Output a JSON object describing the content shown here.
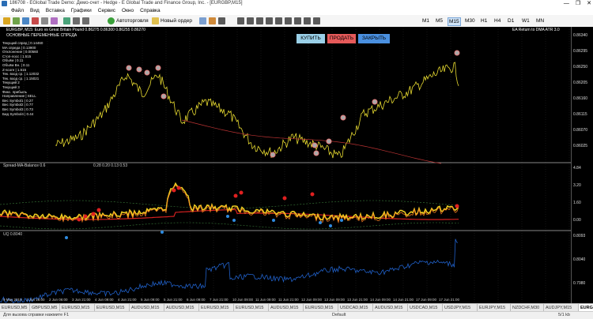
{
  "window": {
    "title": "186708 - EGlobal Trade Demo: Демо-счет - Hedge - E Global Trade and Finance Group, Inc. - [EURGBP,M15]",
    "controls": [
      "—",
      "❐",
      "✕"
    ]
  },
  "menu": [
    "Файл",
    "Вид",
    "Вставка",
    "Графики",
    "Сервис",
    "Окно",
    "Справка"
  ],
  "toolbar": {
    "algo_label": "Автоторговля",
    "new_order_label": "Новый ордер",
    "timeframes": [
      "M1",
      "M5",
      "M15",
      "M30",
      "H1",
      "H4",
      "D1",
      "W1",
      "MN"
    ],
    "active_timeframe": "M15"
  },
  "chart": {
    "header": "EURGBP, M15: Euro vs Great Britain Pound  0.86275  0.86300  0.86255  0.86270",
    "header_sub": "ОСНОВНЫЕ ПЕРЕМЕННЫЕ СПРЕДА",
    "ea_label": "EA Return to DMA ATR 3.0",
    "buttons": {
      "buy": "КУПИТЬ",
      "sell": "ПРОДАТЬ (2)",
      "close": "ЗАКРЫТЬ (2)"
    },
    "indicator1_header": "Spread-MA-Balance 0.6 ",
    "indicator1_values": "0.28  0.20  0.13  0.53",
    "indicator2_header": "UQ  0.8040 ",
    "info_panel": [
      "Текущий спред  |  0.14460",
      "MA спреда      |  0.13900",
      "Отклонение     |  0.00560",
      "Стоп-лосс      |  1.515",
      "Объём          |  0.11",
      "Объём Вн.      |  0.11",
      "Z-score        |  1.515",
      "Тек. вход ср.  |  1.12032",
      "Тек. вход ср.  |  1.15021",
      "Текущий 2",
      "Текущий 3",
      "Фикс. прибыль",
      "Направление    |  SELL",
      "Вес Symbol1    |  0.27",
      "Вес Symbol2    |  0.77",
      "Вес Symbol3    |  0.73",
      "Бид Symbol4    |  0.44"
    ],
    "price_labels": [
      "0.86340",
      "0.86295",
      "0.86250",
      "0.86205",
      "0.86160",
      "0.86115",
      "0.86070",
      "0.86025"
    ],
    "ind1_labels": [
      "4.84",
      "3.20",
      "1.60",
      "0.00"
    ],
    "ind2_labels": [
      "0.8093",
      "0.8040",
      "0.7980"
    ],
    "time_labels": [
      "9 May 2019",
      "1 Jun 18:00",
      "2 Jun 06:00",
      "3 Jun 21:00",
      "4 Jun 09:00",
      "4 Jun 21:00",
      "5 Jun 09:00",
      "5 Jun 21:00",
      "6 Jun 09:00",
      "7 Jun 21:00",
      "10 Jun 09:00",
      "11 Jun 09:00",
      "11 Jun 21:00",
      "12 Jun 09:00",
      "13 Jun 09:00",
      "13 Jun 21:00",
      "14 Jun 09:00",
      "14 Jun 21:00",
      "17 Jun 09:00",
      "17 Jun 21:00"
    ]
  },
  "tabs": [
    "EURUSD,M5",
    "GBPUSD,M5",
    "EURUSD,M15",
    "EURUSD,M15",
    "AUDUSD,M15",
    "AUDUSD,M15",
    "EURUSD,M15",
    "EURUSD,M15",
    "AUDUSD,M15",
    "EURUSD,M15",
    "USDCAD,M15",
    "AUDUSD,M15",
    "USDCAD,M15",
    "USDJPY,M15",
    "EURJPY,M15",
    "NZDCHF,M30",
    "AUDJPY,M15",
    "EURGBP,M15"
  ],
  "active_tab": "EURGBP,M15",
  "status": {
    "help": "Для вызова справки нажмите F1",
    "profile": "Default",
    "traffic": "5/1 kb"
  }
}
